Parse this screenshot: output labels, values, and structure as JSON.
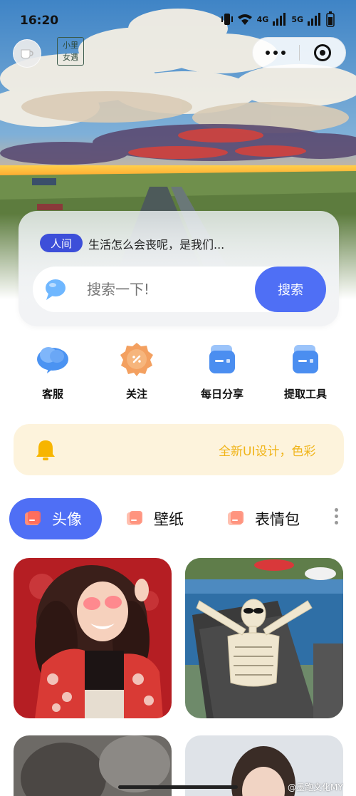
{
  "status_bar": {
    "time": "16:20",
    "net_a": "4G",
    "net_b": "5G"
  },
  "seal": {
    "chars": [
      "小",
      "里",
      "女",
      "遇"
    ]
  },
  "notice_tag": "人间",
  "quote": "生活怎么会丧呢，是我们...",
  "search": {
    "placeholder": "搜索一下!",
    "button": "搜索"
  },
  "actions": [
    {
      "label": "客服",
      "icon": "cloud-icon"
    },
    {
      "label": "关注",
      "icon": "badge-icon"
    },
    {
      "label": "每日分享",
      "icon": "share-icon"
    },
    {
      "label": "提取工具",
      "icon": "tool-icon"
    }
  ],
  "announcement": {
    "text": "全新UI设计，色彩"
  },
  "tabs": [
    {
      "label": "头像",
      "active": true
    },
    {
      "label": "壁纸",
      "active": false
    },
    {
      "label": "表情包",
      "active": false
    }
  ],
  "watermark": "@墨跑文化MY",
  "colors": {
    "accent": "#4f6ff5",
    "tag": "#3d4fd9",
    "notice_bg": "#fdf3dc",
    "notice_text": "#f0b419"
  }
}
